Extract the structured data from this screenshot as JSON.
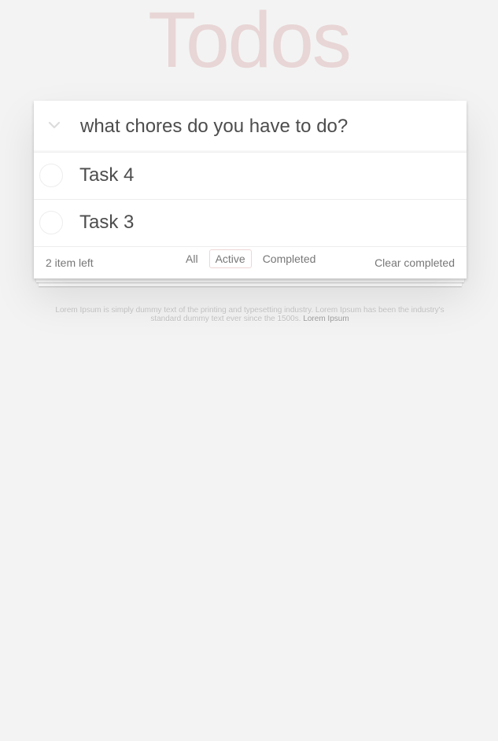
{
  "app": {
    "title": "Todos"
  },
  "new_todo": {
    "placeholder": "what chores do you have to do?"
  },
  "toggle_all": {
    "icon": "chevron-down-icon"
  },
  "todos": [
    {
      "label": "Task 4",
      "completed": false
    },
    {
      "label": "Task 3",
      "completed": false
    }
  ],
  "footer": {
    "count_text": "2 item left",
    "filters": [
      {
        "label": "All",
        "selected": false
      },
      {
        "label": "Active",
        "selected": true
      },
      {
        "label": "Completed",
        "selected": false
      }
    ],
    "clear_label": "Clear completed"
  },
  "info": {
    "text": "Lorem Ipsum is simply dummy text of the printing and typesetting industry. Lorem Ipsum has been the industry's standard dummy text ever since the 1500s.",
    "link": "Lorem Ipsum"
  },
  "colors": {
    "title": "#efd9d9",
    "background": "#f3f3f3",
    "selected_filter_border": "#e6c9c9"
  }
}
